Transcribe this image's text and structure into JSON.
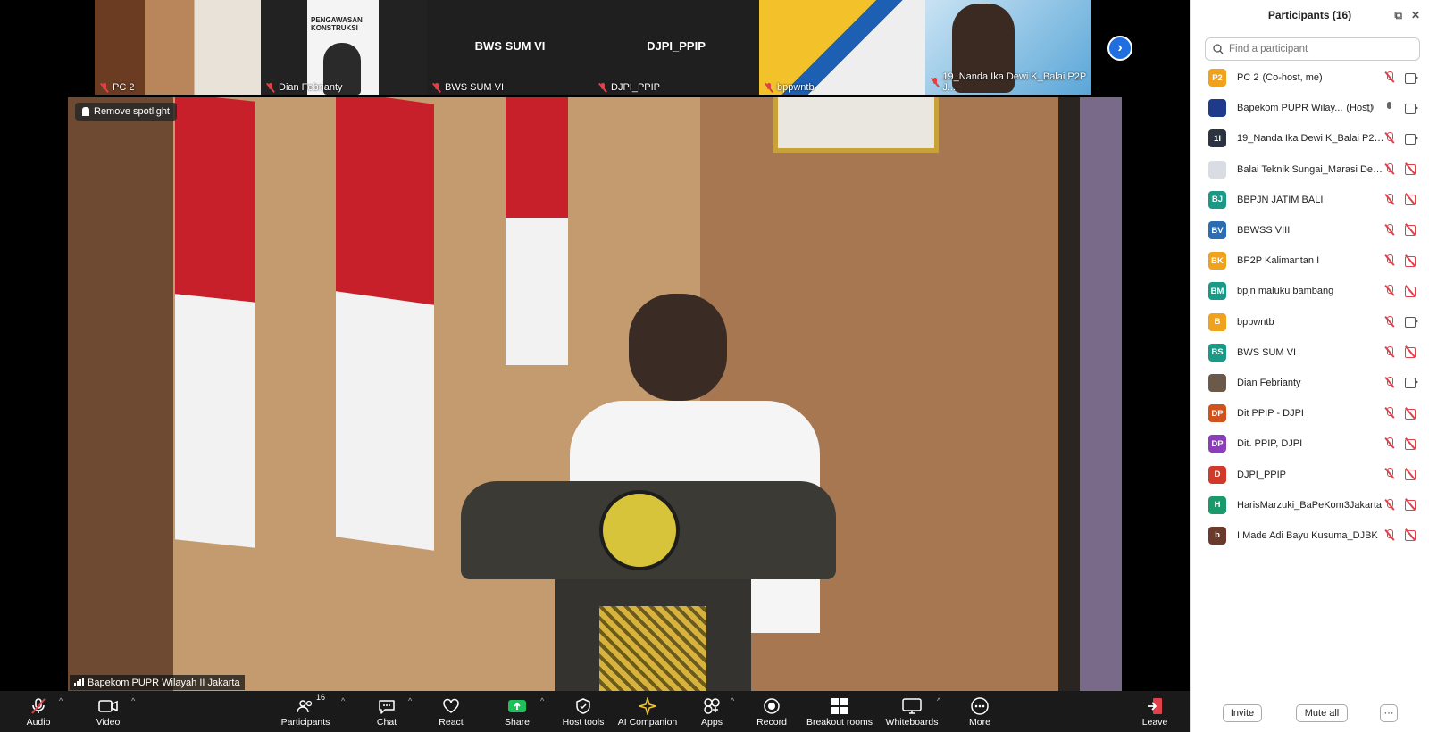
{
  "thumbnails": [
    {
      "name": "PC 2"
    },
    {
      "name": "Dian Febrianty",
      "poster_text": "PENGAWASAN KONSTRUKSI"
    },
    {
      "name": "BWS SUM VI",
      "big_label": "BWS SUM VI"
    },
    {
      "name": "DJPI_PPIP",
      "big_label": "DJPI_PPIP"
    },
    {
      "name": "bppwntb"
    },
    {
      "name": "19_Nanda Ika Dewi K_Balai P2P J..."
    }
  ],
  "spotlight": {
    "remove_label": "Remove spotlight",
    "speaker_name": "Bapekom PUPR Wilayah II Jakarta"
  },
  "toolbar": {
    "audio": "Audio",
    "video": "Video",
    "participants": "Participants",
    "participants_count": "16",
    "chat": "Chat",
    "react": "React",
    "share": "Share",
    "host_tools": "Host tools",
    "ai_companion": "AI Companion",
    "apps": "Apps",
    "record": "Record",
    "breakout_rooms": "Breakout rooms",
    "whiteboards": "Whiteboards",
    "more": "More",
    "leave": "Leave"
  },
  "panel": {
    "title": "Participants (16)",
    "search_placeholder": "Find a participant",
    "invite": "Invite",
    "mute_all": "Mute all",
    "more": "···",
    "participants": [
      {
        "initials": "P2",
        "color": "#f0a21c",
        "name": "PC 2",
        "role": "(Co-host, me)",
        "mic": "off",
        "video": "on"
      },
      {
        "initials": "",
        "color": "#1f3a8a",
        "name": "Bapekom PUPR Wilay...",
        "role": "(Host)",
        "mic": "on",
        "video": "on"
      },
      {
        "initials": "1I",
        "color": "#2b3440",
        "name": "19_Nanda Ika Dewi K_Balai P2P J...",
        "role": "",
        "mic": "off",
        "video": "on"
      },
      {
        "initials": "",
        "color": "#d9dde3",
        "name": "Balai Teknik Sungai_Marasi Deon...",
        "role": "",
        "mic": "off",
        "video": "off"
      },
      {
        "initials": "BJ",
        "color": "#1a9a86",
        "name": "BBPJN JATIM BALI",
        "role": "",
        "mic": "off",
        "video": "off"
      },
      {
        "initials": "BV",
        "color": "#2a6db5",
        "name": "BBWSS VIII",
        "role": "",
        "mic": "off",
        "video": "off"
      },
      {
        "initials": "BK",
        "color": "#f0a21c",
        "name": "BP2P Kalimantan I",
        "role": "",
        "mic": "off",
        "video": "off"
      },
      {
        "initials": "BM",
        "color": "#1a9a86",
        "name": "bpjn maluku bambang",
        "role": "",
        "mic": "off",
        "video": "off"
      },
      {
        "initials": "B",
        "color": "#f0a21c",
        "name": "bppwntb",
        "role": "",
        "mic": "off",
        "video": "on"
      },
      {
        "initials": "BS",
        "color": "#1a9a86",
        "name": "BWS SUM VI",
        "role": "",
        "mic": "off",
        "video": "off"
      },
      {
        "initials": "",
        "color": "#6b5a4a",
        "name": "Dian Febrianty",
        "role": "",
        "mic": "off",
        "video": "on"
      },
      {
        "initials": "DP",
        "color": "#d0521c",
        "name": "Dit PPIP - DJPI",
        "role": "",
        "mic": "off",
        "video": "off"
      },
      {
        "initials": "DP",
        "color": "#8a3fb8",
        "name": "Dit. PPIP, DJPI",
        "role": "",
        "mic": "off",
        "video": "off"
      },
      {
        "initials": "D",
        "color": "#d03a2a",
        "name": "DJPI_PPIP",
        "role": "",
        "mic": "off",
        "video": "off"
      },
      {
        "initials": "H",
        "color": "#1a9a6a",
        "name": "HarisMarzuki_BaPeKom3Jakarta",
        "role": "",
        "mic": "off",
        "video": "off"
      },
      {
        "initials": "b",
        "color": "#6a3a2a",
        "name": "I Made Adi Bayu Kusuma_DJBK",
        "role": "",
        "mic": "off",
        "video": "off"
      }
    ]
  }
}
